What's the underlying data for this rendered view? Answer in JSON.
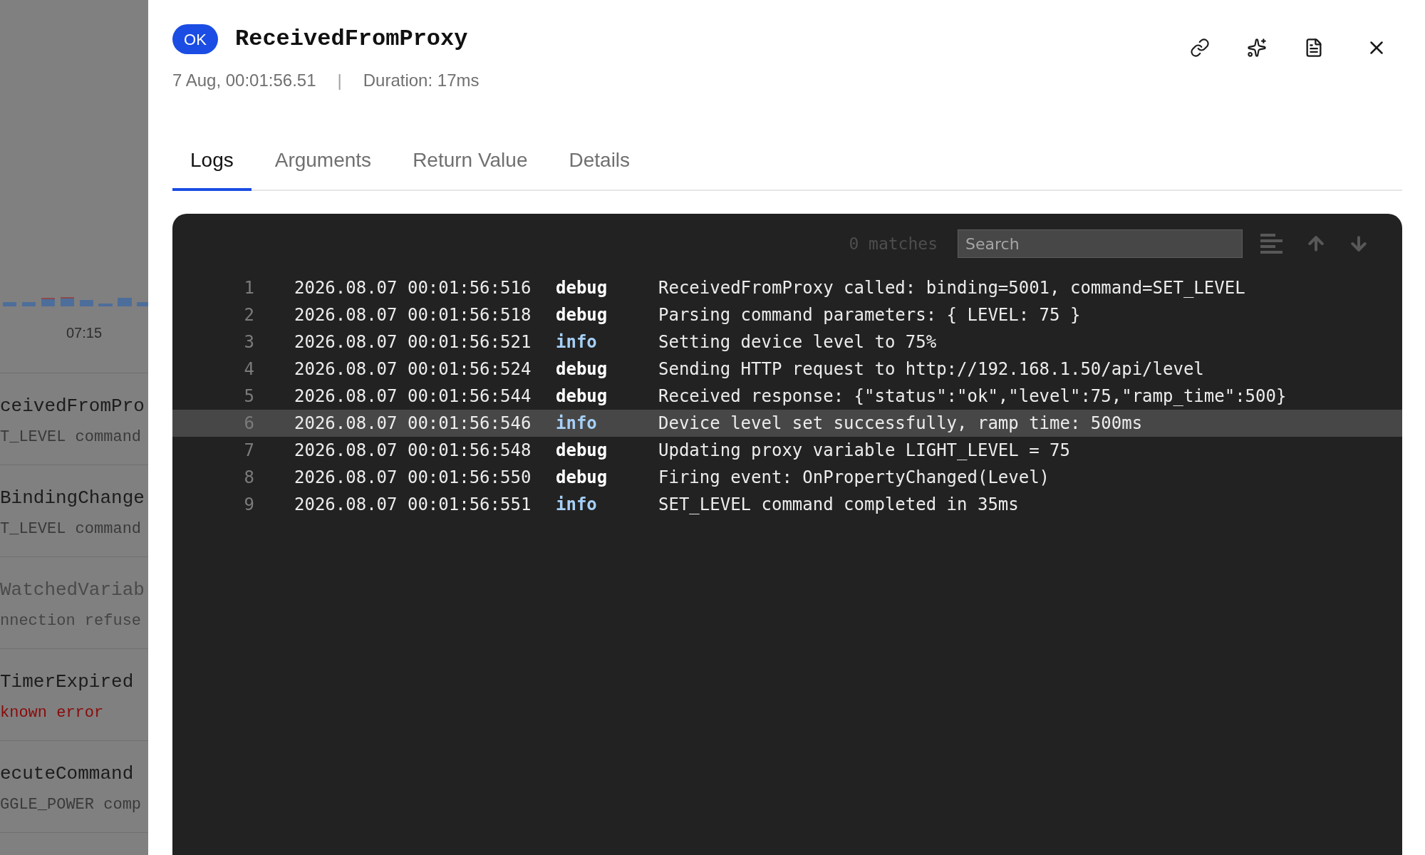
{
  "background_panel": {
    "axis_label": "07:15",
    "events": [
      {
        "title": "ceivedFromPro",
        "subtitle": "T_LEVEL command",
        "kind": "normal"
      },
      {
        "title": "BindingChange",
        "subtitle": "T_LEVEL command",
        "kind": "normal"
      },
      {
        "title": "WatchedVariab",
        "subtitle": "nnection refuse",
        "kind": "faded"
      },
      {
        "title": "TimerExpired",
        "subtitle": "known error",
        "kind": "error"
      },
      {
        "title": "ecuteCommand",
        "subtitle": "GGLE_POWER comp",
        "kind": "normal"
      }
    ]
  },
  "header": {
    "status": "OK",
    "title": "ReceivedFromProxy",
    "timestamp": "7 Aug, 00:01:56.51",
    "separator": "|",
    "duration": "Duration: 17ms"
  },
  "tabs": [
    {
      "label": "Logs",
      "selected": true
    },
    {
      "label": "Arguments",
      "selected": false
    },
    {
      "label": "Return Value",
      "selected": false
    },
    {
      "label": "Details",
      "selected": false
    }
  ],
  "log_toolbar": {
    "matches": "0 matches",
    "search": {
      "placeholder": "Search"
    }
  },
  "logs": [
    {
      "line": "1",
      "time": "2026.08.07 00:01:56:516",
      "level": "debug",
      "kind": "debug",
      "message": "ReceivedFromProxy called: binding=5001, command=SET_LEVEL",
      "selected": false
    },
    {
      "line": "2",
      "time": "2026.08.07 00:01:56:518",
      "level": "debug",
      "kind": "debug",
      "message": "Parsing command parameters: { LEVEL: 75 }",
      "selected": false
    },
    {
      "line": "3",
      "time": "2026.08.07 00:01:56:521",
      "level": "info",
      "kind": "info",
      "message": "Setting device level to 75%",
      "selected": false
    },
    {
      "line": "4",
      "time": "2026.08.07 00:01:56:524",
      "level": "debug",
      "kind": "debug",
      "message": "Sending HTTP request to http://192.168.1.50/api/level",
      "selected": false
    },
    {
      "line": "5",
      "time": "2026.08.07 00:01:56:544",
      "level": "debug",
      "kind": "debug",
      "message": "Received response: {\"status\":\"ok\",\"level\":75,\"ramp_time\":500}",
      "selected": false
    },
    {
      "line": "6",
      "time": "2026.08.07 00:01:56:546",
      "level": "info",
      "kind": "info",
      "message": "Device level set successfully, ramp time: 500ms",
      "selected": true
    },
    {
      "line": "7",
      "time": "2026.08.07 00:01:56:548",
      "level": "debug",
      "kind": "debug",
      "message": "Updating proxy variable LIGHT_LEVEL = 75",
      "selected": false
    },
    {
      "line": "8",
      "time": "2026.08.07 00:01:56:550",
      "level": "debug",
      "kind": "debug",
      "message": "Firing event: OnPropertyChanged(Level)",
      "selected": false
    },
    {
      "line": "9",
      "time": "2026.08.07 00:01:56:551",
      "level": "info",
      "kind": "info",
      "message": "SET_LEVEL command completed in 35ms",
      "selected": false
    }
  ]
}
